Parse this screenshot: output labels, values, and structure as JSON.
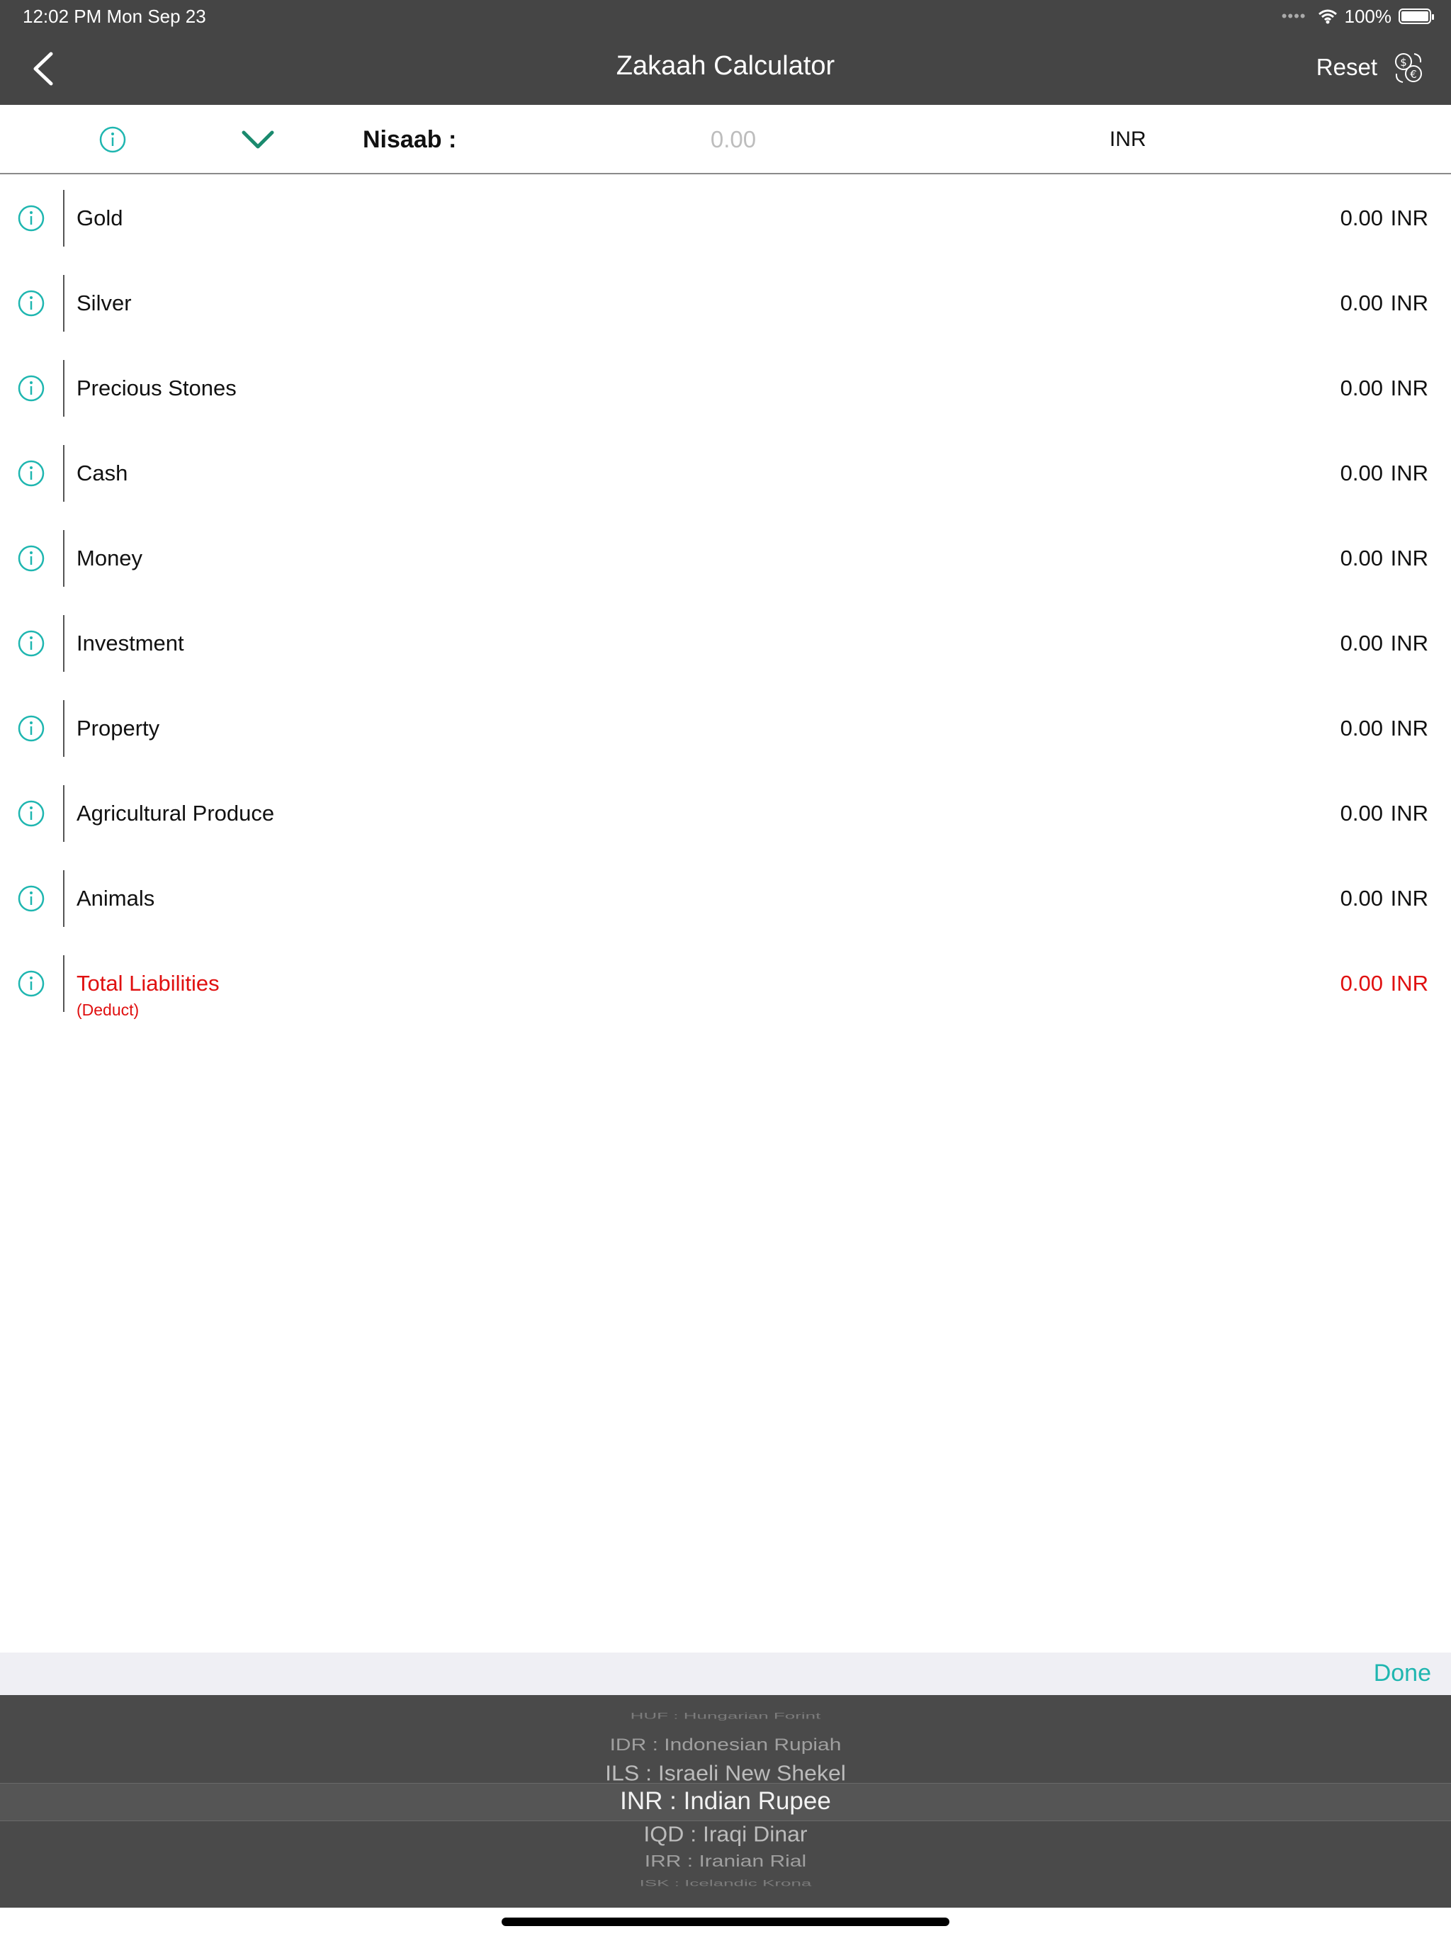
{
  "status_bar": {
    "time_date": "12:02 PM   Mon Sep 23",
    "signal": "••••",
    "battery": "100%"
  },
  "nav": {
    "title": "Zakaah Calculator",
    "reset_label": "Reset"
  },
  "nisaab": {
    "label": "Nisaab :",
    "value_placeholder": "0.00",
    "currency": "INR"
  },
  "assets": [
    {
      "label": "Gold",
      "amount": "0.00",
      "currency": "INR"
    },
    {
      "label": "Silver",
      "amount": "0.00",
      "currency": "INR"
    },
    {
      "label": "Precious Stones",
      "amount": "0.00",
      "currency": "INR"
    },
    {
      "label": "Cash",
      "amount": "0.00",
      "currency": "INR"
    },
    {
      "label": "Money",
      "amount": "0.00",
      "currency": "INR"
    },
    {
      "label": "Investment",
      "amount": "0.00",
      "currency": "INR"
    },
    {
      "label": "Property",
      "amount": "0.00",
      "currency": "INR"
    },
    {
      "label": "Agricultural Produce",
      "amount": "0.00",
      "currency": "INR"
    },
    {
      "label": "Animals",
      "amount": "0.00",
      "currency": "INR"
    }
  ],
  "liabilities": {
    "label": "Total Liabilities",
    "sublabel": "(Deduct)",
    "amount": "0.00",
    "currency": "INR"
  },
  "picker": {
    "done_label": "Done",
    "options": [
      "HUF : Hungarian Forint",
      "IDR : Indonesian Rupiah",
      "ILS : Israeli New Shekel",
      "INR : Indian Rupee",
      "IQD : Iraqi Dinar",
      "IRR : Iranian Rial",
      "ISK : Icelandic Krona"
    ],
    "selected": "INR : Indian Rupee"
  },
  "colors": {
    "bar": "#454545",
    "accent_teal": "#1fb6b0",
    "chevron_green": "#1a8a6e",
    "liability_red": "#e01010"
  }
}
